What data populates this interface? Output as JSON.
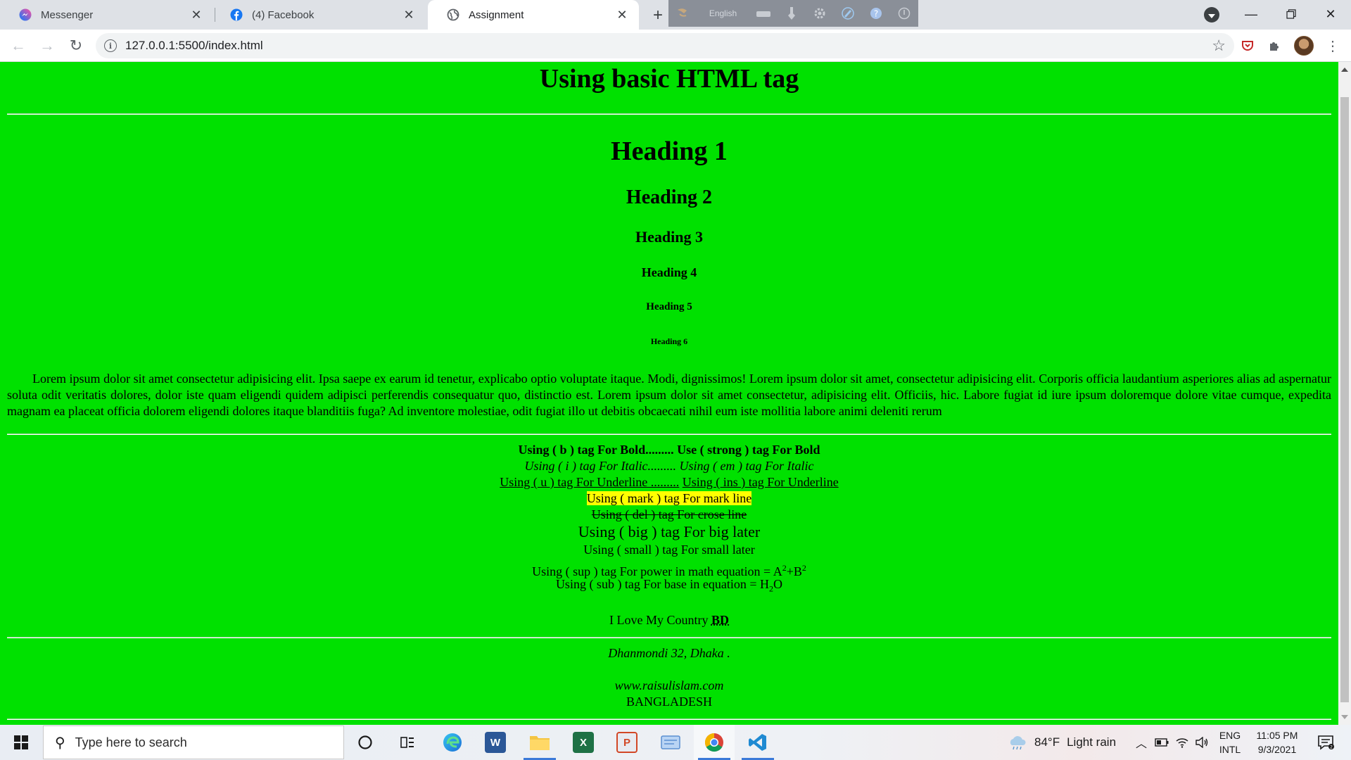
{
  "browser": {
    "tabs": [
      {
        "title": "Messenger",
        "icon": "messenger-icon",
        "active": false
      },
      {
        "title": "(4) Facebook",
        "icon": "facebook-icon",
        "active": false
      },
      {
        "title": "Assignment",
        "icon": "globe-icon",
        "active": true
      }
    ],
    "language_bar": {
      "language": "English"
    },
    "url": "127.0.0.1:5500/index.html"
  },
  "page": {
    "title": "Using basic HTML tag",
    "headings": [
      "Heading 1",
      "Heading 2",
      "Heading 3",
      "Heading 4",
      "Heading 5",
      "Heading 6"
    ],
    "paragraph": "Lorem ipsum dolor sit amet consectetur adipisicing elit. Ipsa saepe ex earum id tenetur, explicabo optio voluptate itaque. Modi, dignissimos! Lorem ipsum dolor sit amet, consectetur adipisicing elit. Corporis officia laudantium asperiores alias ad aspernatur soluta odit veritatis dolores, dolor iste quam eligendi quidem adipisci perferendis consequatur quo, distinctio est. Lorem ipsum dolor sit amet consectetur, adipisicing elit. Officiis, hic. Labore fugiat id iure ipsum doloremque dolore vitae cumque, expedita magnam ea placeat officia dolorem eligendi dolores itaque blanditiis fuga? Ad inventore molestiae, odit fugiat illo ut debitis obcaecati nihil eum iste mollitia labore animi deleniti rerum",
    "bold": {
      "b": "Using ( b ) tag For Bold.........",
      "strong": "Use ( strong ) tag For Bold"
    },
    "italic": {
      "i": "Using ( i ) tag For Italic.........",
      "em": "Using ( em ) tag For Italic"
    },
    "underline": {
      "u": "Using ( u ) tag For Underline .........",
      "ins": "Using ( ins ) tag For Underline"
    },
    "mark": "Using ( mark ) tag For mark line",
    "del": "Using ( del ) tag For crose line",
    "big": "Using ( big ) tag For big later",
    "small": "Using ( small ) tag For small later",
    "sup": {
      "text": "Using ( sup ) tag For power in math equation = A",
      "exp1": "2",
      "plus": "+B",
      "exp2": "2"
    },
    "sub": {
      "text": "Using ( sub ) tag For base in equation = H",
      "sub": "2",
      "after": "O"
    },
    "love": {
      "text": "I Love My Country ",
      "abbr": "BD"
    },
    "address": {
      "line1": "Dhanmondi 32, Dhaka .",
      "line2": "www.raisulislam.com",
      "country": "BANGLADESH"
    }
  },
  "taskbar": {
    "search_placeholder": "Type here to search",
    "weather": {
      "temp": "84°F",
      "desc": "Light rain"
    },
    "lang": {
      "top": "ENG",
      "bottom": "INTL"
    },
    "clock": {
      "time": "11:05 PM",
      "date": "9/3/2021"
    }
  }
}
